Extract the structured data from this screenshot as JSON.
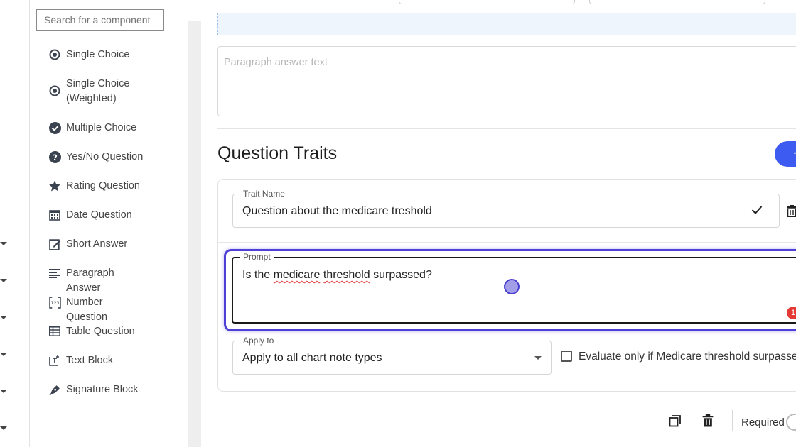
{
  "search": {
    "placeholder": "Search for a component"
  },
  "components": [
    {
      "label": "Single Choice",
      "icon": "radio-icon"
    },
    {
      "label": "Single Choice (Weighted)",
      "icon": "radio-icon"
    },
    {
      "label": "Multiple Choice",
      "icon": "check-circle-icon"
    },
    {
      "label": "Yes/No Question",
      "icon": "question-circle-icon"
    },
    {
      "label": "Rating Question",
      "icon": "star-icon"
    },
    {
      "label": "Date Question",
      "icon": "calendar-icon"
    },
    {
      "label": "Short Answer",
      "icon": "edit-icon"
    },
    {
      "label": "Paragraph Answer",
      "icon": "paragraph-icon"
    },
    {
      "label": "Number Question",
      "icon": "number-icon"
    },
    {
      "label": "Table Question",
      "icon": "table-icon"
    },
    {
      "label": "Text Block",
      "icon": "text-block-icon"
    },
    {
      "label": "Signature Block",
      "icon": "signature-icon"
    }
  ],
  "editor": {
    "paragraph_placeholder": "Paragraph answer text",
    "section_title": "Question Traits",
    "add_button_label": "+",
    "trait": {
      "trait_name_label": "Trait Name",
      "trait_name_value": "Question about the medicare treshold",
      "prompt_label": "Prompt",
      "prompt_parts": [
        "Is the ",
        "medicare",
        " ",
        "threshold",
        " surpassed?"
      ],
      "apply_to_label": "Apply to",
      "apply_to_value": "Apply to all chart note types",
      "evaluate_label": "Evaluate only if Medicare threshold surpassed",
      "error_count": "1"
    },
    "required_label": "Required"
  },
  "colors": {
    "accent": "#3d5af1",
    "focus": "#4e3fd6",
    "error": "#e53935"
  }
}
